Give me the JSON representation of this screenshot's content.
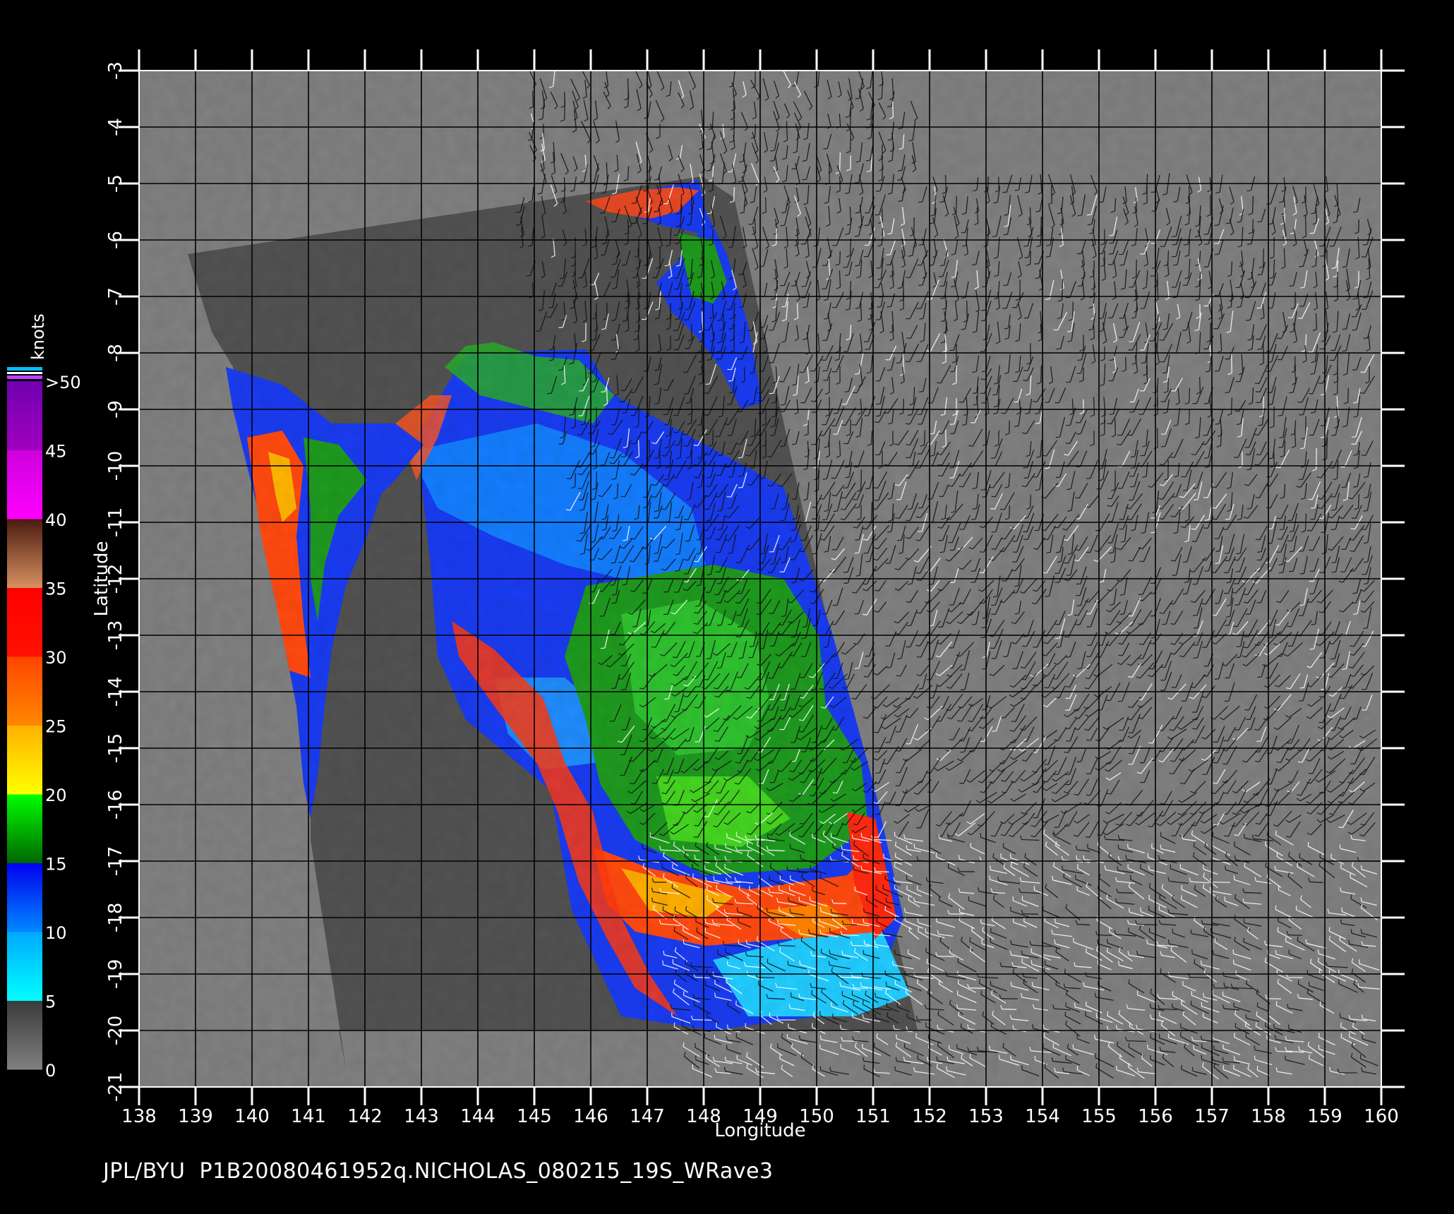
{
  "map": {
    "x_axis": {
      "label": "Longitude",
      "range": [
        138,
        160
      ],
      "ticks": [
        "138",
        "139",
        "140",
        "141",
        "142",
        "143",
        "144",
        "145",
        "146",
        "147",
        "148",
        "149",
        "150",
        "151",
        "152",
        "153",
        "154",
        "155",
        "156",
        "157",
        "158",
        "159",
        "160"
      ]
    },
    "y_axis": {
      "label": "Latitude",
      "range": [
        -21,
        -3
      ],
      "ticks": [
        "-3",
        "-4",
        "-5",
        "-6",
        "-7",
        "-8",
        "-9",
        "-10",
        "-11",
        "-12",
        "-13",
        "-14",
        "-15",
        "-16",
        "-17",
        "-18",
        "-19",
        "-20",
        "-21"
      ]
    },
    "grid": true,
    "background_color": "#808080",
    "swath_color": "#525252"
  },
  "colorbar": {
    "unit": "knots",
    "labels": [
      ">50",
      "45",
      "40",
      "35",
      "30",
      "25",
      "20",
      "15",
      "10",
      "5",
      "0"
    ],
    "segments": [
      {
        "from": 0,
        "to": 5,
        "colors": [
          "#808080",
          "#3a3a3a"
        ]
      },
      {
        "from": 5,
        "to": 10,
        "colors": [
          "#00ffff",
          "#00a8ff"
        ]
      },
      {
        "from": 10,
        "to": 15,
        "colors": [
          "#0088ff",
          "#0000ee"
        ]
      },
      {
        "from": 15,
        "to": 20,
        "colors": [
          "#006600",
          "#00ff00"
        ]
      },
      {
        "from": 20,
        "to": 25,
        "colors": [
          "#ffff00",
          "#ffb000"
        ]
      },
      {
        "from": 25,
        "to": 30,
        "colors": [
          "#ff8800",
          "#ff4400"
        ]
      },
      {
        "from": 30,
        "to": 35,
        "colors": [
          "#ff1100",
          "#ff0000"
        ]
      },
      {
        "from": 35,
        "to": 40,
        "colors": [
          "#d89060",
          "#4a1a10"
        ]
      },
      {
        "from": 40,
        "to": 45,
        "colors": [
          "#ff00ff",
          "#cc00dd"
        ]
      },
      {
        "from": 45,
        "to": 50,
        "colors": [
          "#a000c0",
          "#7000b0"
        ]
      }
    ]
  },
  "footer": {
    "text": "JPL/BYU  P1B20080461952q.NICHOLAS_080215_19S_WRave3"
  }
}
